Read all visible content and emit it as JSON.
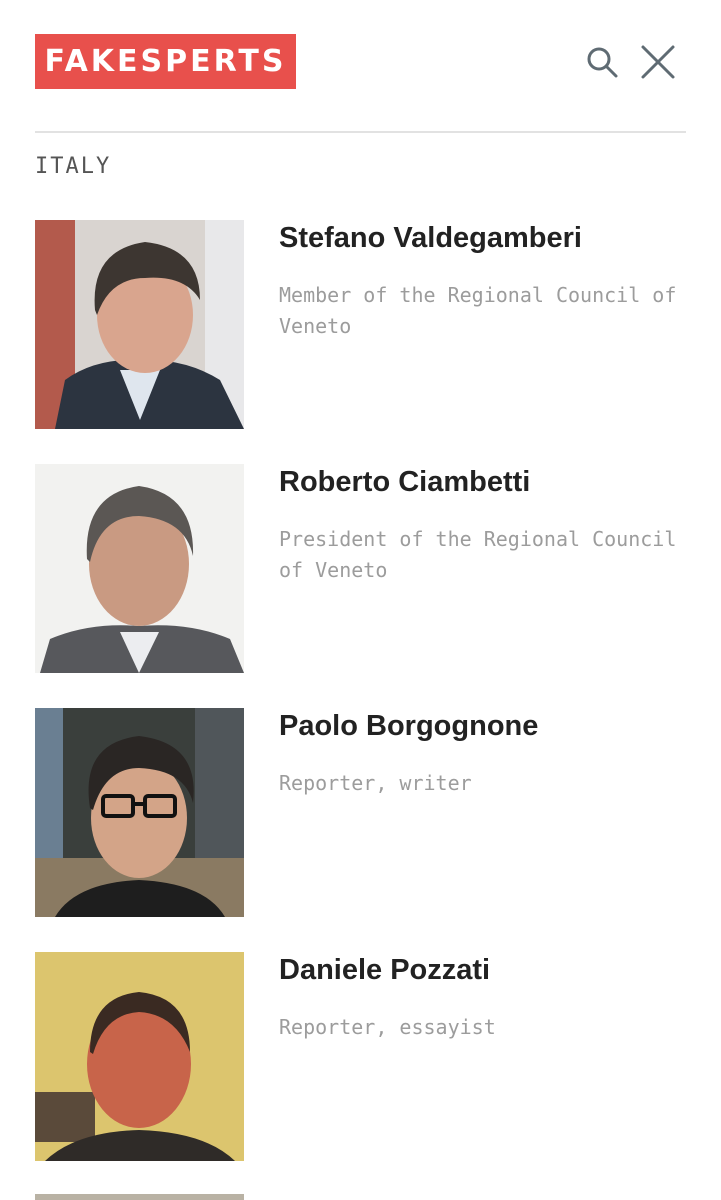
{
  "header": {
    "logo_text": "FAKESPERTS",
    "search_icon": "search-icon",
    "close_icon": "close-icon",
    "brand_color": "#e8504c"
  },
  "section": {
    "label": "ITALY"
  },
  "people": [
    {
      "name": "Stefano Valdegamberi",
      "role": "Member of the Regional Council of Veneto"
    },
    {
      "name": "Roberto Ciambetti",
      "role": "President of the Regional Council of Veneto"
    },
    {
      "name": "Paolo Borgognone",
      "role": "Reporter, writer"
    },
    {
      "name": "Daniele Pozzati",
      "role": "Reporter, essayist"
    }
  ]
}
